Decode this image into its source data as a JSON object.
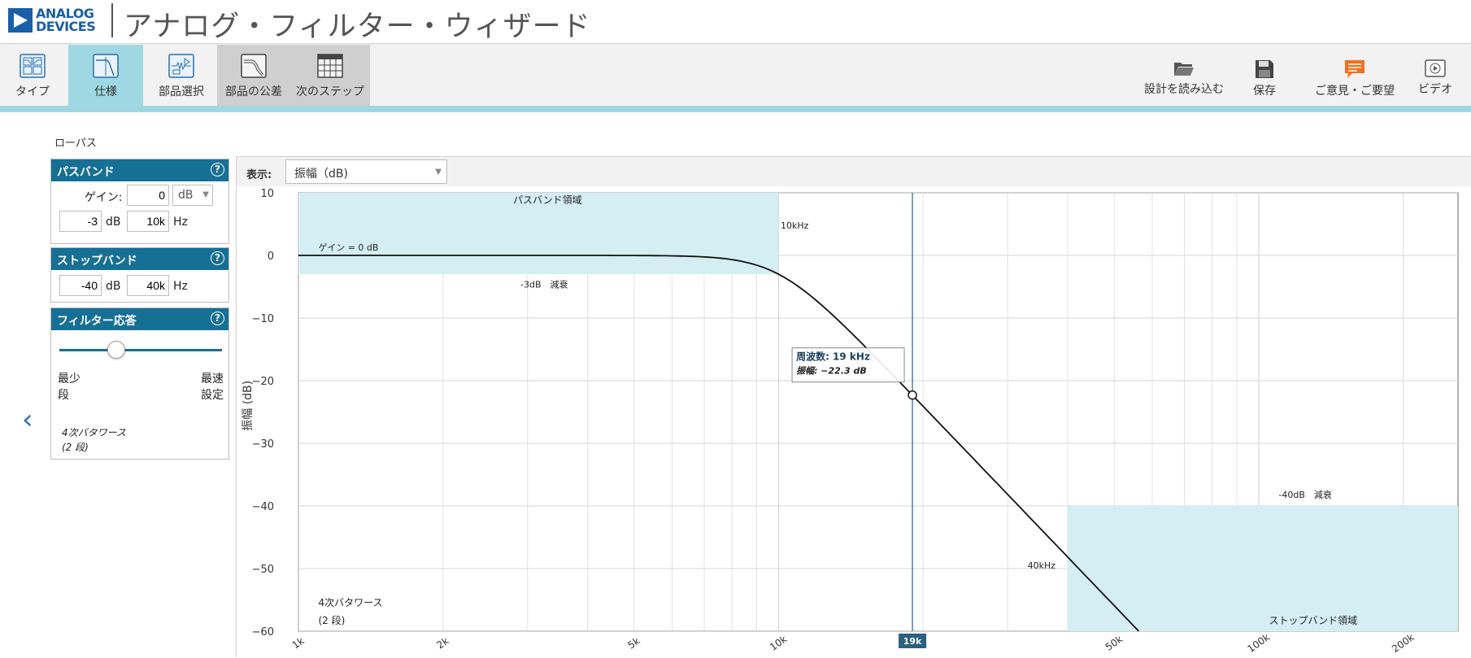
{
  "header": {
    "logo_line1": "ANALOG",
    "logo_line2": "DEVICES",
    "app_title": "アナログ・フィルター・ウィザード"
  },
  "toolbar": {
    "steps": [
      {
        "label": "タイプ",
        "icon": "filter-type-icon",
        "state": "normal"
      },
      {
        "label": "仕様",
        "icon": "specification-icon",
        "state": "active"
      },
      {
        "label": "部品選択",
        "icon": "component-selection-icon",
        "state": "normal"
      },
      {
        "label": "部品の公差",
        "icon": "tolerance-icon",
        "state": "disabled"
      },
      {
        "label": "次のステップ",
        "icon": "next-steps-table-icon",
        "state": "disabled"
      }
    ],
    "actions": [
      {
        "label": "設計を読み込む",
        "icon": "folder-open-icon"
      },
      {
        "label": "保存",
        "icon": "floppy-save-icon"
      },
      {
        "label": "ご意見・ご要望",
        "icon": "feedback-chat-icon"
      },
      {
        "label": "ビデオ",
        "icon": "video-play-icon"
      }
    ],
    "feedback_color": "#f37021"
  },
  "breadcrumb": "ローパス",
  "passband": {
    "title": "パスバンド",
    "gain_label": "ゲイン:",
    "gain_value": "0",
    "gain_unit": "dB",
    "atten_value": "-3",
    "atten_unit": "dB",
    "freq_value": "10k",
    "freq_unit": "Hz"
  },
  "stopband": {
    "title": "ストップバンド",
    "atten_value": "-40",
    "atten_unit": "dB",
    "freq_value": "40k",
    "freq_unit": "Hz"
  },
  "response": {
    "title": "フィルター応答",
    "slider_value": 0.35,
    "left_label_1": "最少",
    "left_label_2": "段",
    "right_label_1": "最速",
    "right_label_2": "設定",
    "type_line1": "4次バタワース",
    "type_line2": "(2 段)"
  },
  "display": {
    "label": "表示:",
    "selected": "振幅（dB)"
  },
  "colors": {
    "header_blue": "#166f95",
    "accent_cyan": "#9fd8e2",
    "region_fill": "#d4eef3",
    "logo_blue": "#1a5ea8"
  },
  "chart_data": {
    "type": "line",
    "ylabel": "振幅 (dB)",
    "x_scale": "log",
    "xlim": [
      1000,
      260000
    ],
    "ylim": [
      -60,
      10
    ],
    "y_ticks": [
      10,
      0,
      -10,
      -20,
      -30,
      -40,
      -50,
      -60
    ],
    "x_ticks": [
      {
        "value": 1000,
        "label": "1k"
      },
      {
        "value": 2000,
        "label": "2k"
      },
      {
        "value": 5000,
        "label": "5k"
      },
      {
        "value": 10000,
        "label": "10k"
      },
      {
        "value": 50000,
        "label": "50k"
      },
      {
        "value": 100000,
        "label": "100k"
      },
      {
        "value": 200000,
        "label": "200k"
      }
    ],
    "grid": true,
    "series": [
      {
        "filter_order": 4,
        "cutoff_hz": 10000,
        "x": [
          1000,
          2000,
          5000,
          7000,
          10000,
          14000,
          19000,
          30000,
          40000,
          56000
        ],
        "y": [
          0,
          0,
          -0.07,
          -0.5,
          -3,
          -11.8,
          -22.3,
          -38.2,
          -48.2,
          -60
        ]
      }
    ],
    "passband_region": {
      "label": "パスバンド領域",
      "x_max": 10000,
      "y_min": -3
    },
    "stopband_region": {
      "label": "ストップバンド領域",
      "x_min": 40000,
      "y_max": -40
    },
    "annotations": {
      "gain": "ゲイン = 0 dB",
      "passband_atten": "-3dB　減衰",
      "stopband_atten": "-40dB　減衰",
      "corner_freq": "10kHz",
      "stop_freq": "40kHz",
      "order_line1": "4次バタワース",
      "order_line2": "(2 段)"
    },
    "cursor": {
      "x": 19000,
      "y": -22.3,
      "x_badge": "19k",
      "freq_label": "周波数: 19 kHz",
      "amp_label": "振幅: −22.3 dB"
    }
  }
}
